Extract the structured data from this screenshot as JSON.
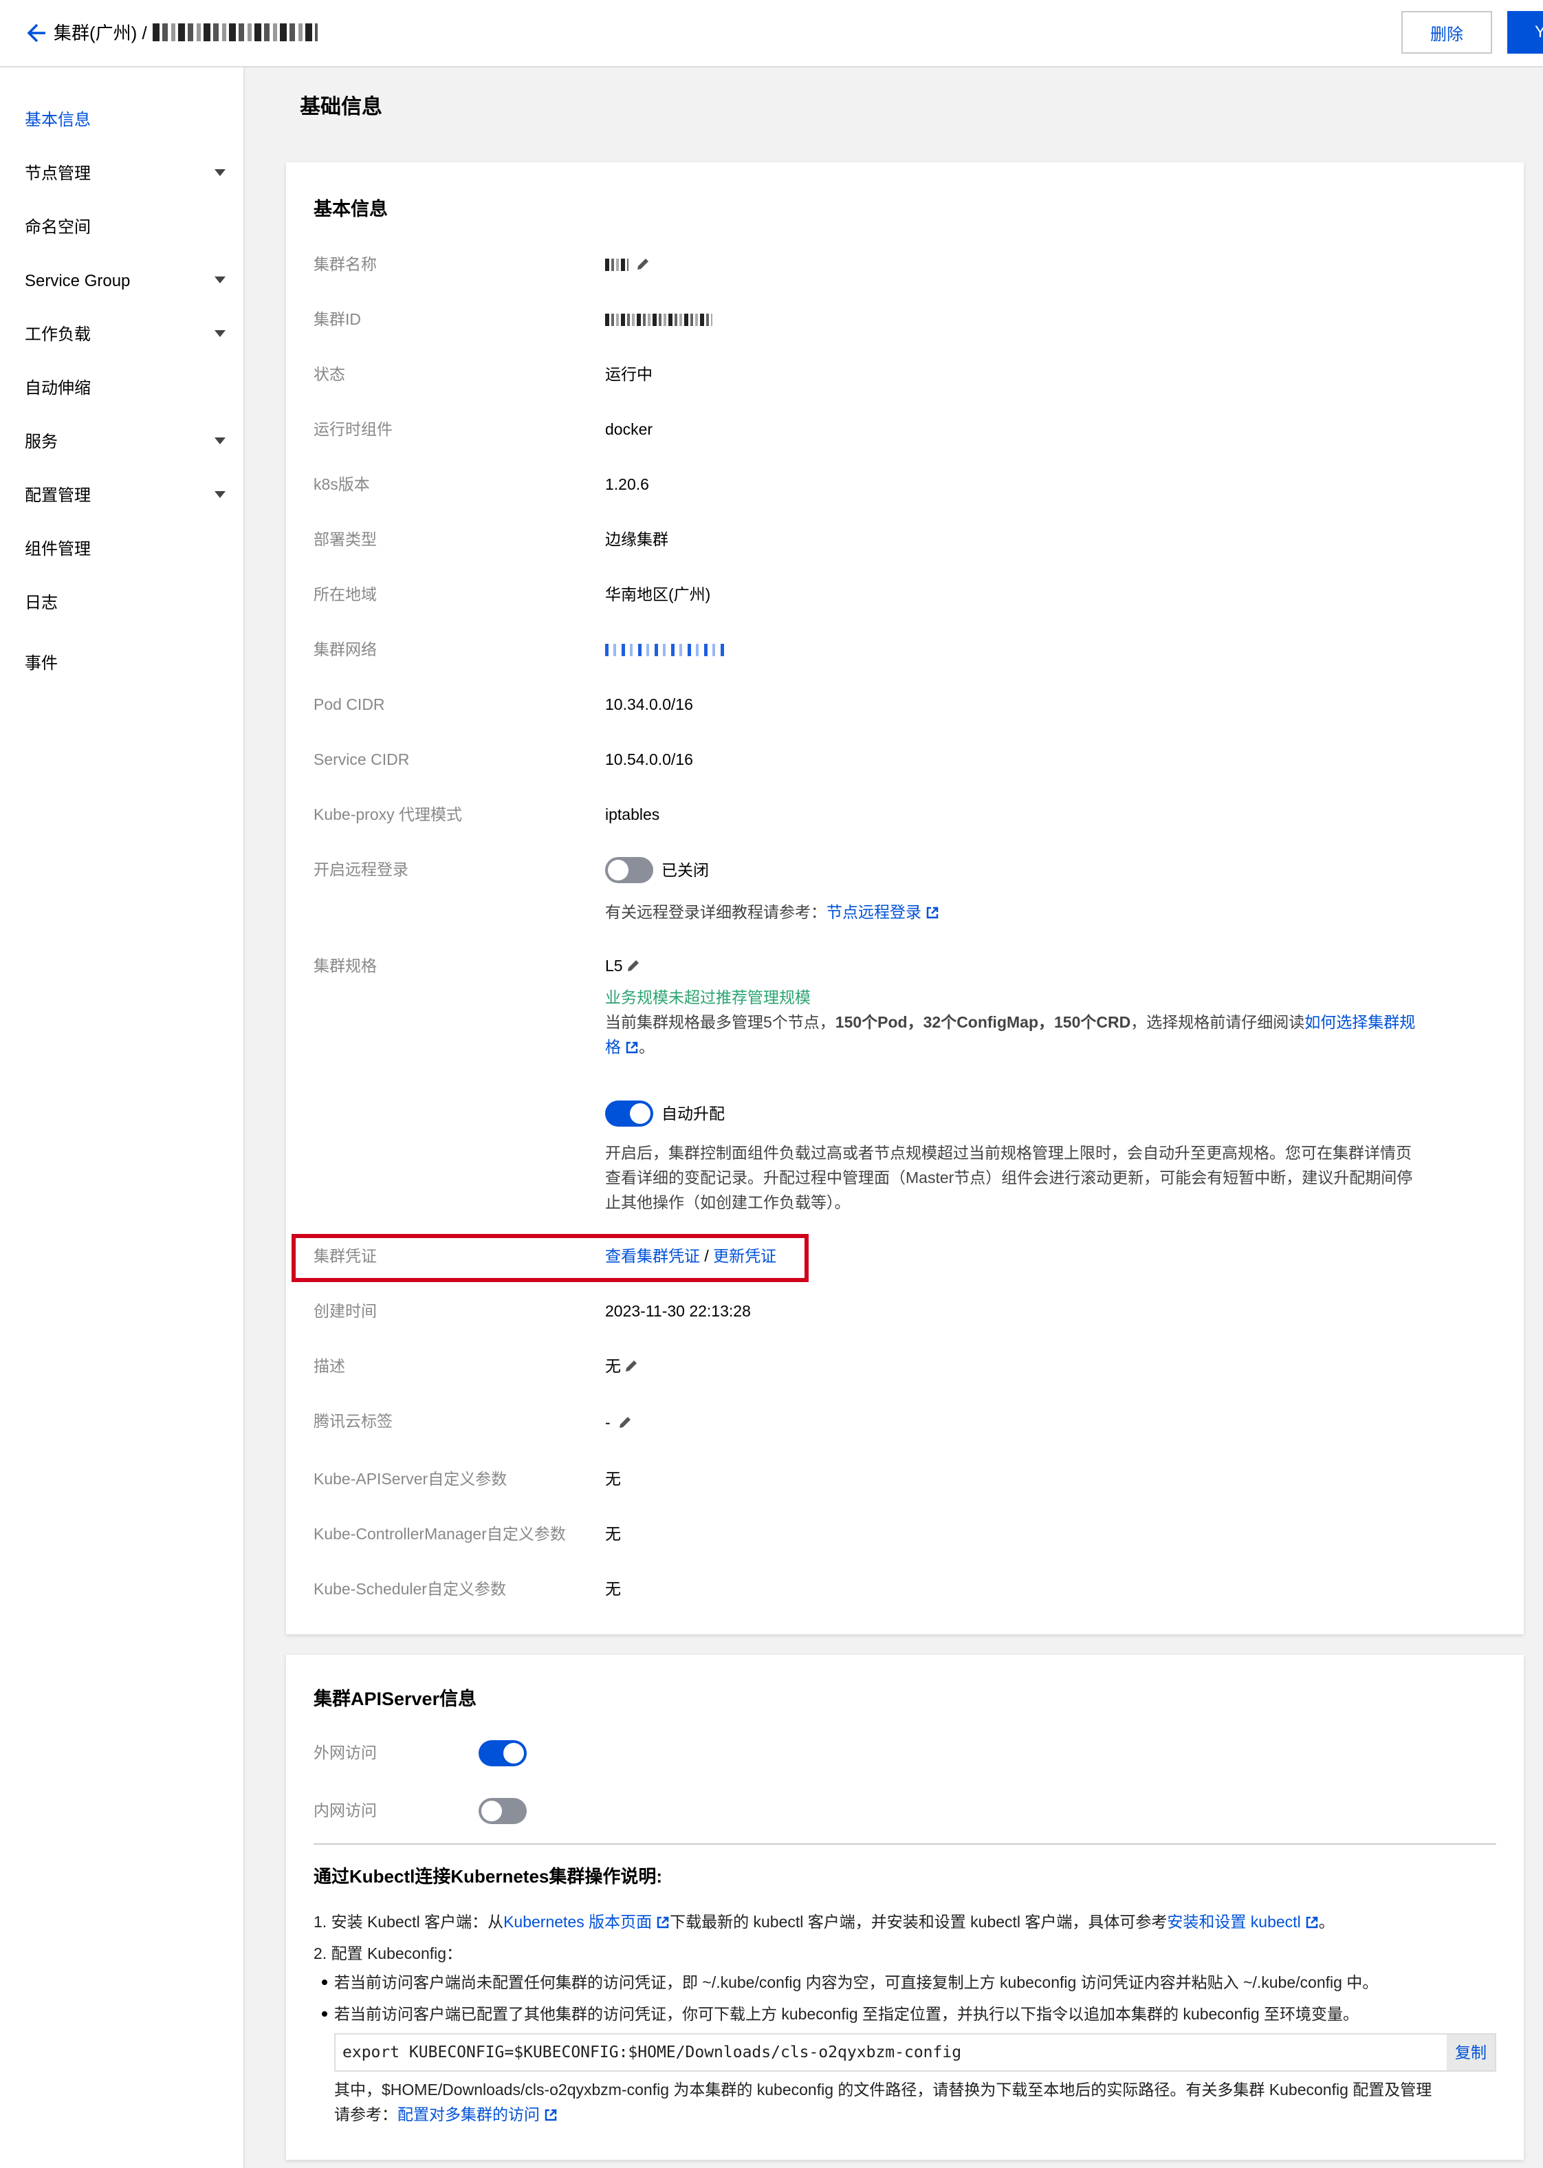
{
  "header": {
    "breadcrumb_parent": "集群(广州) /",
    "delete_label": "删除",
    "primary_label": "Y"
  },
  "sidebar": {
    "items": [
      {
        "label": "基本信息",
        "active": true
      },
      {
        "label": "节点管理",
        "expandable": true
      },
      {
        "label": "命名空间"
      },
      {
        "label": "Service Group",
        "expandable": true
      },
      {
        "label": "工作负载",
        "expandable": true
      },
      {
        "label": "自动伸缩"
      },
      {
        "label": "服务",
        "expandable": true
      },
      {
        "label": "配置管理",
        "expandable": true
      },
      {
        "label": "组件管理"
      },
      {
        "label": "日志"
      },
      {
        "label": "事件"
      }
    ]
  },
  "page_title": "基础信息",
  "basic": {
    "title": "基本信息",
    "rows": {
      "name": {
        "label": "集群名称"
      },
      "id": {
        "label": "集群ID"
      },
      "status": {
        "label": "状态",
        "value": "运行中"
      },
      "runtime": {
        "label": "运行时组件",
        "value": "docker"
      },
      "k8s": {
        "label": "k8s版本",
        "value": "1.20.6"
      },
      "deploy": {
        "label": "部署类型",
        "value": "边缘集群"
      },
      "region": {
        "label": "所在地域",
        "value": "华南地区(广州)"
      },
      "network": {
        "label": "集群网络"
      },
      "pod_cidr": {
        "label": "Pod CIDR",
        "value": "10.34.0.0/16"
      },
      "svc_cidr": {
        "label": "Service CIDR",
        "value": "10.54.0.0/16"
      },
      "kube_proxy": {
        "label": "Kube-proxy 代理模式",
        "value": "iptables"
      },
      "remote_login": {
        "label": "开启远程登录",
        "toggle_state": "已关闭",
        "hint_prefix": "有关远程登录详细教程请参考：",
        "hint_link": "节点远程登录"
      },
      "spec": {
        "label": "集群规格",
        "value": "L5",
        "status_text": "业务规模未超过推荐管理规模",
        "desc_line1_prefix": "当前集群规格最多管理5个节点，",
        "desc_line1_bold": "150个Pod，32个ConfigMap，150个CRD",
        "desc_line1_suffix": "，选择规格前请仔细阅读",
        "desc_link_part1": "如何选择集群规",
        "desc_link_part2": "格",
        "desc_end": "。",
        "auto_upgrade_label": "自动升配",
        "auto_desc_1": "开启后，集群控制面组件负载过高或者节点规模超过当前规格管理上限时，会自动升至更高规格。您可在集群详情页",
        "auto_desc_2": "查看详细的变配记录。升配过程中管理面（Master节点）组件会进行滚动更新，可能会有短暂中断，建议升配期间停",
        "auto_desc_3": "止其他操作（如创建工作负载等）。"
      },
      "credential": {
        "label": "集群凭证",
        "link1": "查看集群凭证",
        "sep": "/",
        "link2": "更新凭证"
      },
      "created": {
        "label": "创建时间",
        "value": "2023-11-30 22:13:28"
      },
      "desc": {
        "label": "描述",
        "value": "无"
      },
      "tags": {
        "label": "腾讯云标签",
        "value": "-"
      },
      "apiserver_params": {
        "label": "Kube-APIServer自定义参数",
        "value": "无"
      },
      "cm_params": {
        "label": "Kube-ControllerManager自定义参数",
        "value": "无"
      },
      "scheduler_params": {
        "label": "Kube-Scheduler自定义参数",
        "value": "无"
      }
    }
  },
  "apiserver": {
    "title": "集群APIServer信息",
    "external": {
      "label": "外网访问",
      "enabled": true
    },
    "internal": {
      "label": "内网访问",
      "enabled": false
    },
    "guide_title": "通过Kubectl连接Kubernetes集群操作说明:",
    "step1_prefix": "1. 安装 Kubectl 客户端：从",
    "step1_link1": "Kubernetes 版本页面",
    "step1_mid": "下载最新的 kubectl 客户端，并安装和设置 kubectl 客户端，具体可参考",
    "step1_link2": "安装和设置 kubectl",
    "step1_end": "。",
    "step2": "2. 配置 Kubeconfig：",
    "bullet1": "若当前访问客户端尚未配置任何集群的访问凭证，即 ~/.kube/config 内容为空，可直接复制上方 kubeconfig 访问凭证内容并粘贴入 ~/.kube/config 中。",
    "bullet2": "若当前访问客户端已配置了其他集群的访问凭证，你可下载上方 kubeconfig 至指定位置，并执行以下指令以追加本集群的 kubeconfig 至环境变量。",
    "command": "export KUBECONFIG=$KUBECONFIG:$HOME/Downloads/cls-o2qyxbzm-config",
    "copy_label": "复制",
    "note_line1": "其中，$HOME/Downloads/cls-o2qyxbzm-config 为本集群的 kubeconfig 的文件路径，请替换为下载至本地后的实际路径。有关多集群 Kubeconfig 配置及管理",
    "note_line2_prefix": "请参考：",
    "note_link": "配置对多集群的访问"
  },
  "colors": {
    "accent": "#0052d9",
    "success": "#2ba471",
    "alert_border": "#d0021b"
  }
}
